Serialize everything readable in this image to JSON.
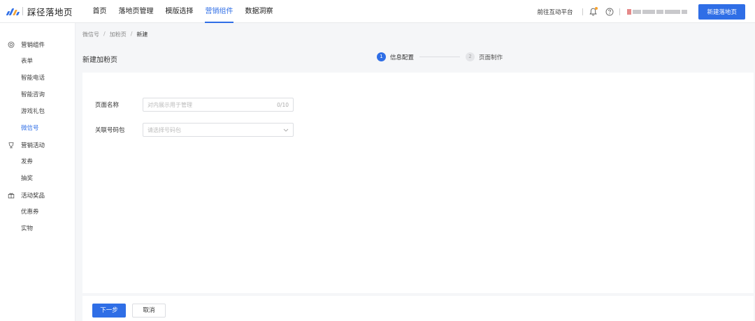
{
  "app": {
    "title": "踩径落地页"
  },
  "nav": {
    "items": [
      {
        "label": "首页"
      },
      {
        "label": "落地页管理"
      },
      {
        "label": "模版选择"
      },
      {
        "label": "营销组件"
      },
      {
        "label": "数据洞察"
      }
    ],
    "active_index": 3
  },
  "header": {
    "platform_link": "前往互动平台",
    "new_page_button": "新建落地页"
  },
  "colors": {
    "accent": "#2f6ee6",
    "notification_dot": "#f7a330"
  },
  "sidebar": {
    "groups": [
      {
        "label": "营销组件",
        "icon": "target-icon",
        "items": [
          "表单",
          "智能电话",
          "智能咨询",
          "游戏礼包",
          "微信号"
        ]
      },
      {
        "label": "营销活动",
        "icon": "trophy-icon",
        "items": [
          "发券",
          "抽奖"
        ]
      },
      {
        "label": "活动奖品",
        "icon": "gift-icon",
        "items": [
          "优惠券",
          "实物"
        ]
      }
    ],
    "active_item": "微信号"
  },
  "breadcrumb": {
    "items": [
      "微信号",
      "加粉页",
      "新建"
    ],
    "separator": "/"
  },
  "page": {
    "title": "新建加粉页"
  },
  "steps": [
    {
      "number": "1",
      "label": "信息配置",
      "state": "active"
    },
    {
      "number": "2",
      "label": "页面制作",
      "state": "pending"
    }
  ],
  "form": {
    "page_name": {
      "label": "页面名称",
      "placeholder": "对内展示用于管理",
      "value": "",
      "counter": "0/10"
    },
    "code_pack": {
      "label": "关联号码包",
      "placeholder": "请选择号码包",
      "value": ""
    }
  },
  "footer": {
    "next_label": "下一步",
    "cancel_label": "取消"
  }
}
